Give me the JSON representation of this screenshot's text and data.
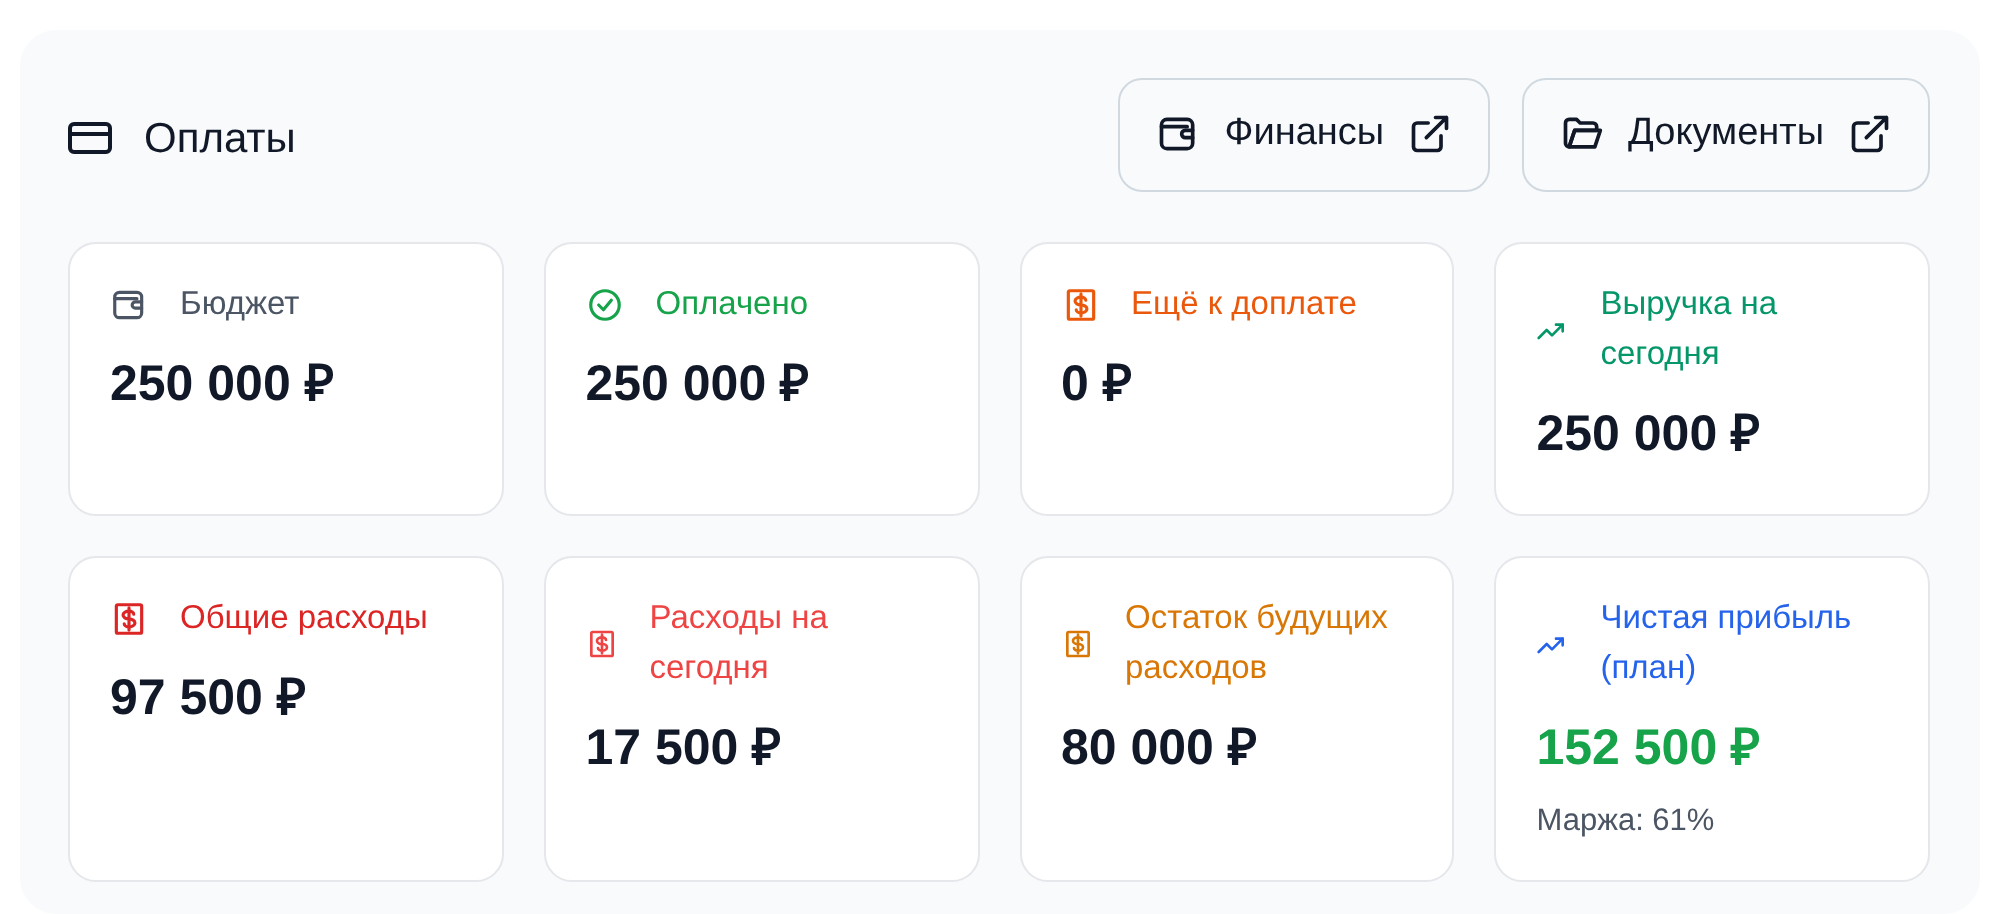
{
  "panel": {
    "title": "Оплаты",
    "links": [
      {
        "label": "Финансы",
        "kind": "wallet"
      },
      {
        "label": "Документы",
        "kind": "folder"
      }
    ]
  },
  "cards": [
    {
      "label": "Бюджет",
      "kind": "wallet",
      "color": "#4b5563",
      "value": "250 000 ₽",
      "highlighted": false
    },
    {
      "label": "Оплачено",
      "kind": "check",
      "color": "#16a34a",
      "value": "250 000 ₽",
      "highlighted": false
    },
    {
      "label": "Ещё к доплате",
      "kind": "dollar",
      "color": "#ea580c",
      "value": "0 ₽",
      "highlighted": false
    },
    {
      "label": "Выручка на сегодня",
      "kind": "trend",
      "color": "#059669",
      "value": "250 000 ₽",
      "highlighted": false
    },
    {
      "label": "Общие расходы",
      "kind": "dollar",
      "color": "#dc2626",
      "value": "97 500 ₽",
      "highlighted": false
    },
    {
      "label": "Расходы на сегодня",
      "kind": "dollar",
      "color": "#ef4444",
      "value": "17 500 ₽",
      "highlighted": false
    },
    {
      "label": "Остаток будущих расходов",
      "kind": "dollar",
      "color": "#d97706",
      "value": "80 000 ₽",
      "highlighted": false
    },
    {
      "label": "Чистая прибыль (план)",
      "kind": "trend",
      "color": "#2563eb",
      "value": "152 500 ₽",
      "highlighted": true,
      "note": "Маржа: 61%"
    }
  ]
}
